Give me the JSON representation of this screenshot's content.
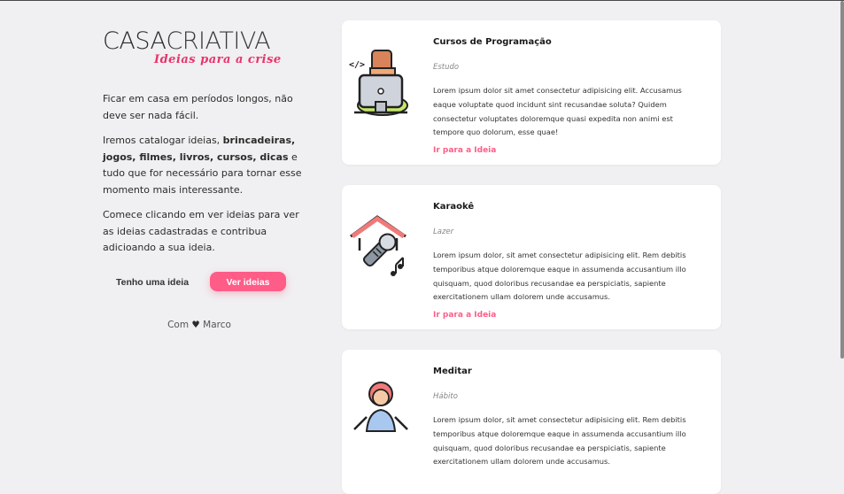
{
  "brand": {
    "name_bold": "CASA",
    "name_light": "CRIATIVA",
    "tagline": "Ideias para a crise"
  },
  "intro": {
    "p1": "Ficar em casa em períodos longos, não deve ser nada fácil.",
    "p2_prefix": "Iremos catalogar ideias, ",
    "p2_bold": "brincadeiras, jogos, filmes, livros, cursos, dicas",
    "p2_suffix": " e tudo que for necessário para tornar esse momento mais interessante.",
    "p3": "Comece clicando em ver ideias para ver as ideias cadastradas e contribua adicioando a sua ideia."
  },
  "buttons": {
    "secondary": "Tenho uma ideia",
    "primary": "Ver ideias"
  },
  "credit": {
    "prefix": "Com",
    "heart": "♥",
    "name": "Marco"
  },
  "ideas": [
    {
      "title": "Cursos de Programação",
      "category": "Estudo",
      "description": "Lorem ipsum dolor sit amet consectetur adipisicing elit. Accusamus eaque voluptate quod incidunt sint recusandae soluta? Quidem consectetur voluptates doloremque quasi expedita non animi est tempore quo dolorum, esse quae!",
      "link": "Ir para a Ideia",
      "icon": "programming-laptop-icon"
    },
    {
      "title": "Karaokê",
      "category": "Lazer",
      "description": "Lorem ipsum dolor, sit amet consectetur adipisicing elit. Rem debitis temporibus atque doloremque eaque in assumenda accusantium illo quisquam, quod doloribus recusandae ea perspiciatis, sapiente exercitationem ullam dolorem unde accusamus.",
      "link": "Ir para a Ideia",
      "icon": "microphone-house-icon"
    },
    {
      "title": "Meditar",
      "category": "Hábito",
      "description": "Lorem ipsum dolor, sit amet consectetur adipisicing elit. Rem debitis temporibus atque doloremque eaque in assumenda accusantium illo quisquam, quod doloribus recusandae ea perspiciatis, sapiente exercitationem ullam dolorem unde accusamus.",
      "link": "Ir para a Ideia",
      "icon": "meditation-person-icon"
    }
  ],
  "colors": {
    "accent": "#ff5c87",
    "tagline": "#e8336b",
    "background": "#f0eff1"
  }
}
